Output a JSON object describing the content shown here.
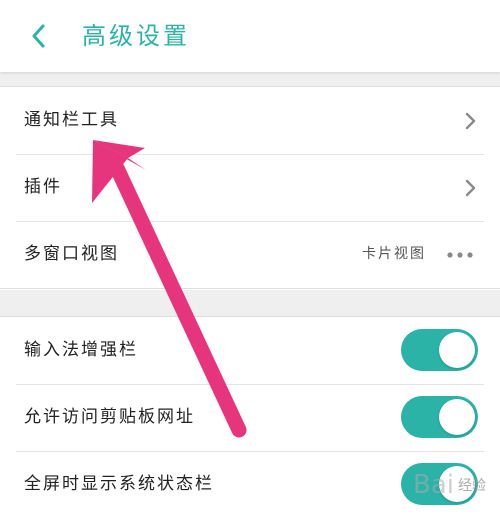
{
  "header": {
    "title": "高级设置",
    "back_icon": "chevron-left-icon",
    "accent_color": "#2bb3a8"
  },
  "group1": {
    "items": [
      {
        "label": "通知栏工具",
        "icon": "chevron-right-icon"
      },
      {
        "label": "插件",
        "icon": "chevron-right-icon"
      },
      {
        "label": "多窗口视图",
        "value": "卡片视图",
        "icon": "more-horizontal-icon"
      }
    ]
  },
  "group2": {
    "items": [
      {
        "label": "输入法增强栏",
        "toggle_on": true
      },
      {
        "label": "允许访问剪贴板网址",
        "toggle_on": true
      },
      {
        "label": "全屏时显示系统状态栏",
        "toggle_on": true
      }
    ]
  },
  "annotation": {
    "arrow_color": "#e6357c",
    "arrow_icon": "pointer-arrow-icon"
  },
  "watermark": {
    "logo": "Bai",
    "text": "经验"
  }
}
